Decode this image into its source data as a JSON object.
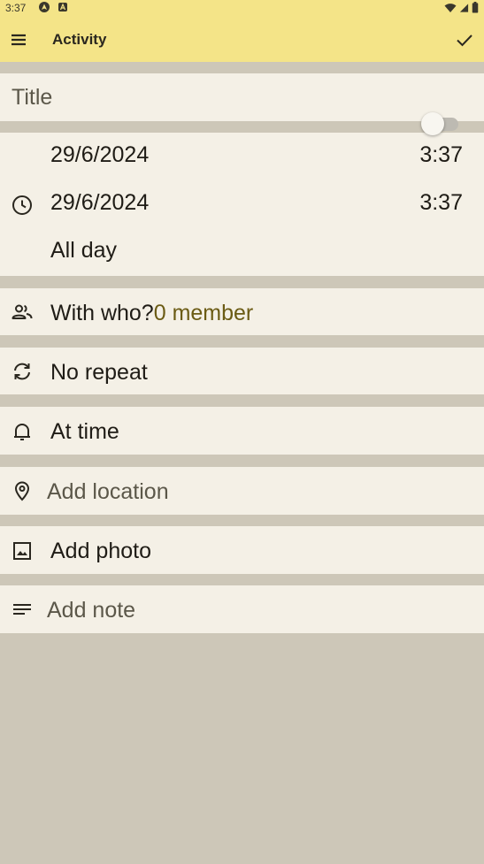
{
  "status_bar": {
    "time": "3:37",
    "left_icons": [
      "autopilot-icon",
      "notification-a-icon"
    ],
    "right_icons": [
      "wifi-icon",
      "signal-icon",
      "battery-icon"
    ]
  },
  "app_bar": {
    "title": "Activity",
    "menu_icon": "menu-icon",
    "confirm_icon": "check-icon"
  },
  "form": {
    "title_placeholder": "Title",
    "start_date": "29/6/2024",
    "start_time": "3:37",
    "end_date": "29/6/2024",
    "end_time": "3:37",
    "all_day_label": "All day",
    "all_day_on": false,
    "with_who_label": "With who?",
    "with_who_value": "0 member",
    "repeat_label": "No repeat",
    "reminder_label": "At time",
    "location_placeholder": "Add location",
    "photo_label": "Add photo",
    "note_placeholder": "Add note"
  },
  "colors": {
    "app_bar": "#f4e488",
    "card": "#f4f0e6",
    "background": "#cdc7b8",
    "accent_text": "#6b5b14"
  }
}
